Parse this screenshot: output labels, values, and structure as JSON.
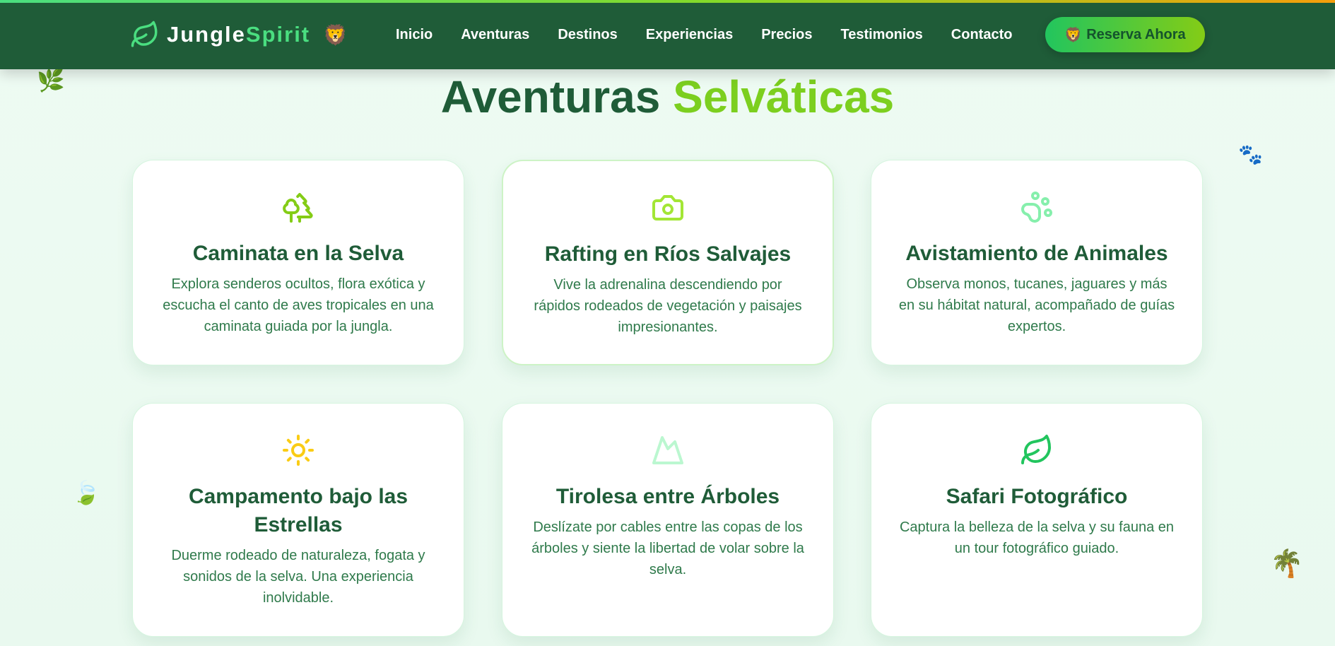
{
  "brand": {
    "part1": "Jungle",
    "part2": "Spirit",
    "emoji": "🦁"
  },
  "nav": [
    "Inicio",
    "Aventuras",
    "Destinos",
    "Experiencias",
    "Precios",
    "Testimonios",
    "Contacto"
  ],
  "cta": {
    "emoji": "🦁",
    "label": "Reserva Ahora"
  },
  "section": {
    "title_part1": "Aventuras",
    "title_part2": "Selváticas"
  },
  "cards": [
    {
      "icon": "tree-icon",
      "icon_color": "#84cc16",
      "title": "Caminata en la Selva",
      "description": "Explora senderos ocultos, flora exótica y escucha el canto de aves tropicales en una caminata guiada por la jungla."
    },
    {
      "icon": "camera-icon",
      "icon_color": "#a3e635",
      "title": "Rafting en Ríos Salvajes",
      "description": "Vive la adrenalina descendiendo por rápidos rodeados de vegetación y paisajes impresionantes."
    },
    {
      "icon": "paw-icon",
      "icon_color": "#86efac",
      "title": "Avistamiento de Animales",
      "description": "Observa monos, tucanes, jaguares y más en su hábitat natural, acompañado de guías expertos."
    },
    {
      "icon": "sun-icon",
      "icon_color": "#facc15",
      "title": "Campamento bajo las Estrellas",
      "description": "Duerme rodeado de naturaleza, fogata y sonidos de la selva. Una experiencia inolvidable."
    },
    {
      "icon": "mountain-icon",
      "icon_color": "#bbf7d0",
      "title": "Tirolesa entre Árboles",
      "description": "Deslízate por cables entre las copas de los árboles y siente la libertad de volar sobre la selva."
    },
    {
      "icon": "leaf-icon",
      "icon_color": "#22c55e",
      "title": "Safari Fotográfico",
      "description": "Captura la belleza de la selva y su fauna en un tour fotográfico guiado."
    }
  ],
  "decorations": {
    "parrot": "🦜",
    "paws": "🐾",
    "butterfly": "🦋",
    "palm": "🌴",
    "leaf": "🍃",
    "herb": "🌿"
  },
  "colors": {
    "nav_bg": "#1f5c38",
    "accent_green": "#4ade80",
    "title_green": "#7ccf1f",
    "text_green": "#2f7a4b"
  }
}
